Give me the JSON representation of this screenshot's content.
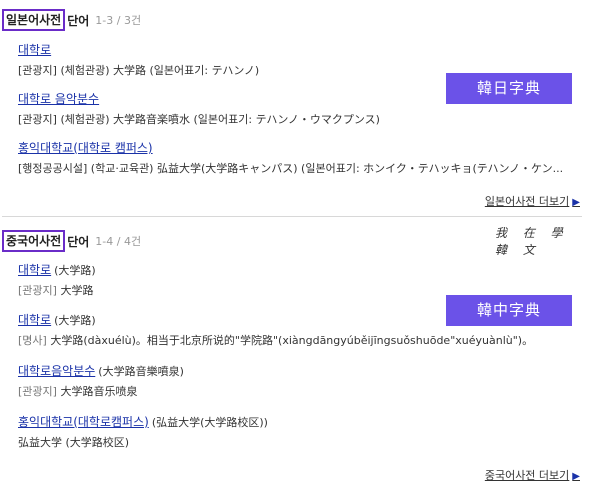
{
  "japanese": {
    "title": "일본어사전",
    "word": "단어",
    "count": "1-3 / 3건",
    "entries": [
      {
        "headword": "대학로",
        "line": "[관광지] (체험관광) 大学路 (일본어표기: テハンノ)"
      },
      {
        "headword": "대학로 음악분수",
        "line": "[관광지] (체험관광) 大学路音楽噴水 (일본어표기: テハンノ・ウマクプンス)"
      },
      {
        "headword": "홍익대학교(대학로 캠퍼스)",
        "line": "[행정공공시설] (학교·교육관) 弘益大学(大学路キャンパス) (일본어표기: ホンイク・テハッキョ(テハンノ・ケン..."
      }
    ],
    "more": "일본어사전 더보기",
    "button": "韓日字典"
  },
  "chinese": {
    "title": "중국어사전",
    "word": "단어",
    "count": "1-4 / 4건",
    "entries": [
      {
        "headword": "대학로",
        "hanja": "(大学路)",
        "tag": "[관광지]",
        "text": "大学路"
      },
      {
        "headword": "대학로",
        "hanja": "(大学路)",
        "tag": "[명사]",
        "text": "大学路(dàxuélù)。相当于北京所说的\"学院路\"(xiàngdāngyúběijīngsuǒshuōde\"xuéyuànlù\")。"
      },
      {
        "headword": "대학로음악분수",
        "hanja": "(大学路音樂噴泉)",
        "tag": "[관광지]",
        "text": "大学路音乐喷泉"
      },
      {
        "headword": "홍익대학교(대학로캠퍼스)",
        "hanja": "(弘益大学(大学路校区))",
        "tag": "",
        "text": "弘益大学 (大学路校区)"
      }
    ],
    "more": "중국어사전 더보기",
    "button": "韓中字典"
  },
  "watermark": "我 在 學 韓 文",
  "icons": {
    "more_arrow": "chevron-right-icon"
  }
}
